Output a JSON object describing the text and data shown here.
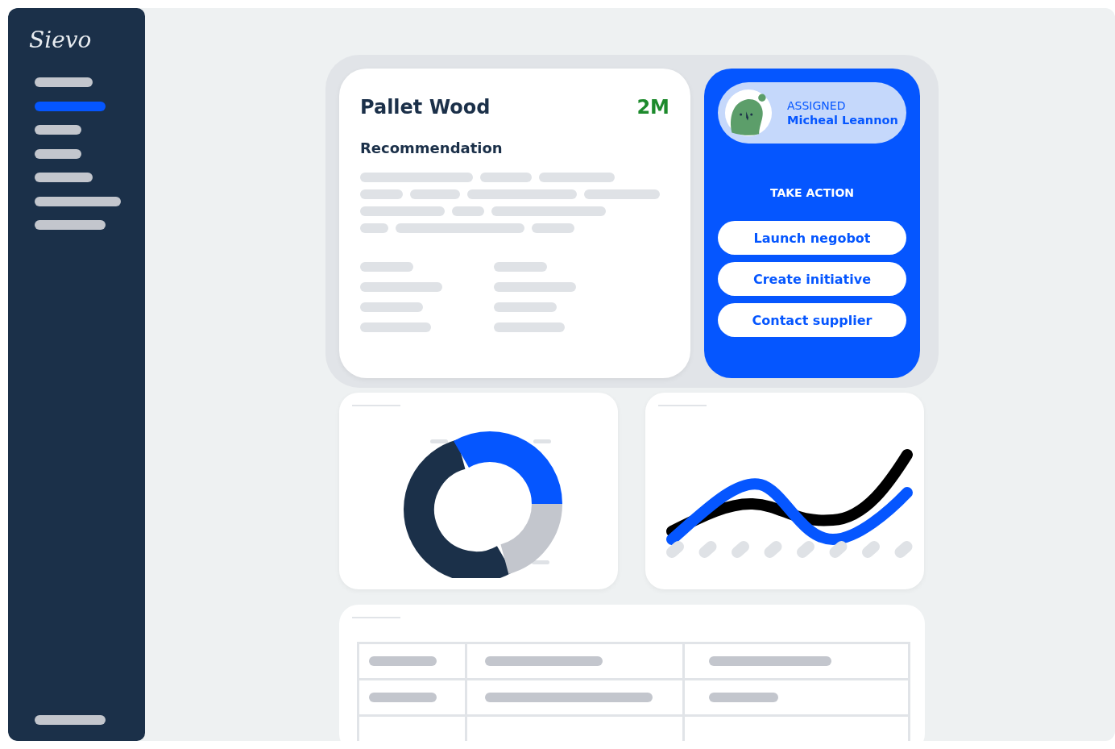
{
  "sidebar": {
    "logo": "Sievo",
    "items": [
      {
        "selected": false
      },
      {
        "selected": true
      },
      {
        "selected": false
      },
      {
        "selected": false
      },
      {
        "selected": false
      },
      {
        "selected": false
      },
      {
        "selected": false
      }
    ]
  },
  "recommendation_card": {
    "title": "Pallet Wood",
    "value": "2M",
    "subtitle": "Recommendation"
  },
  "action_card": {
    "assigned_label": "ASSIGNED",
    "assignee": "Micheal Leannon",
    "heading": "TAKE ACTION",
    "buttons": [
      "Launch negobot",
      "Create initiative",
      "Contact supplier"
    ]
  }
}
